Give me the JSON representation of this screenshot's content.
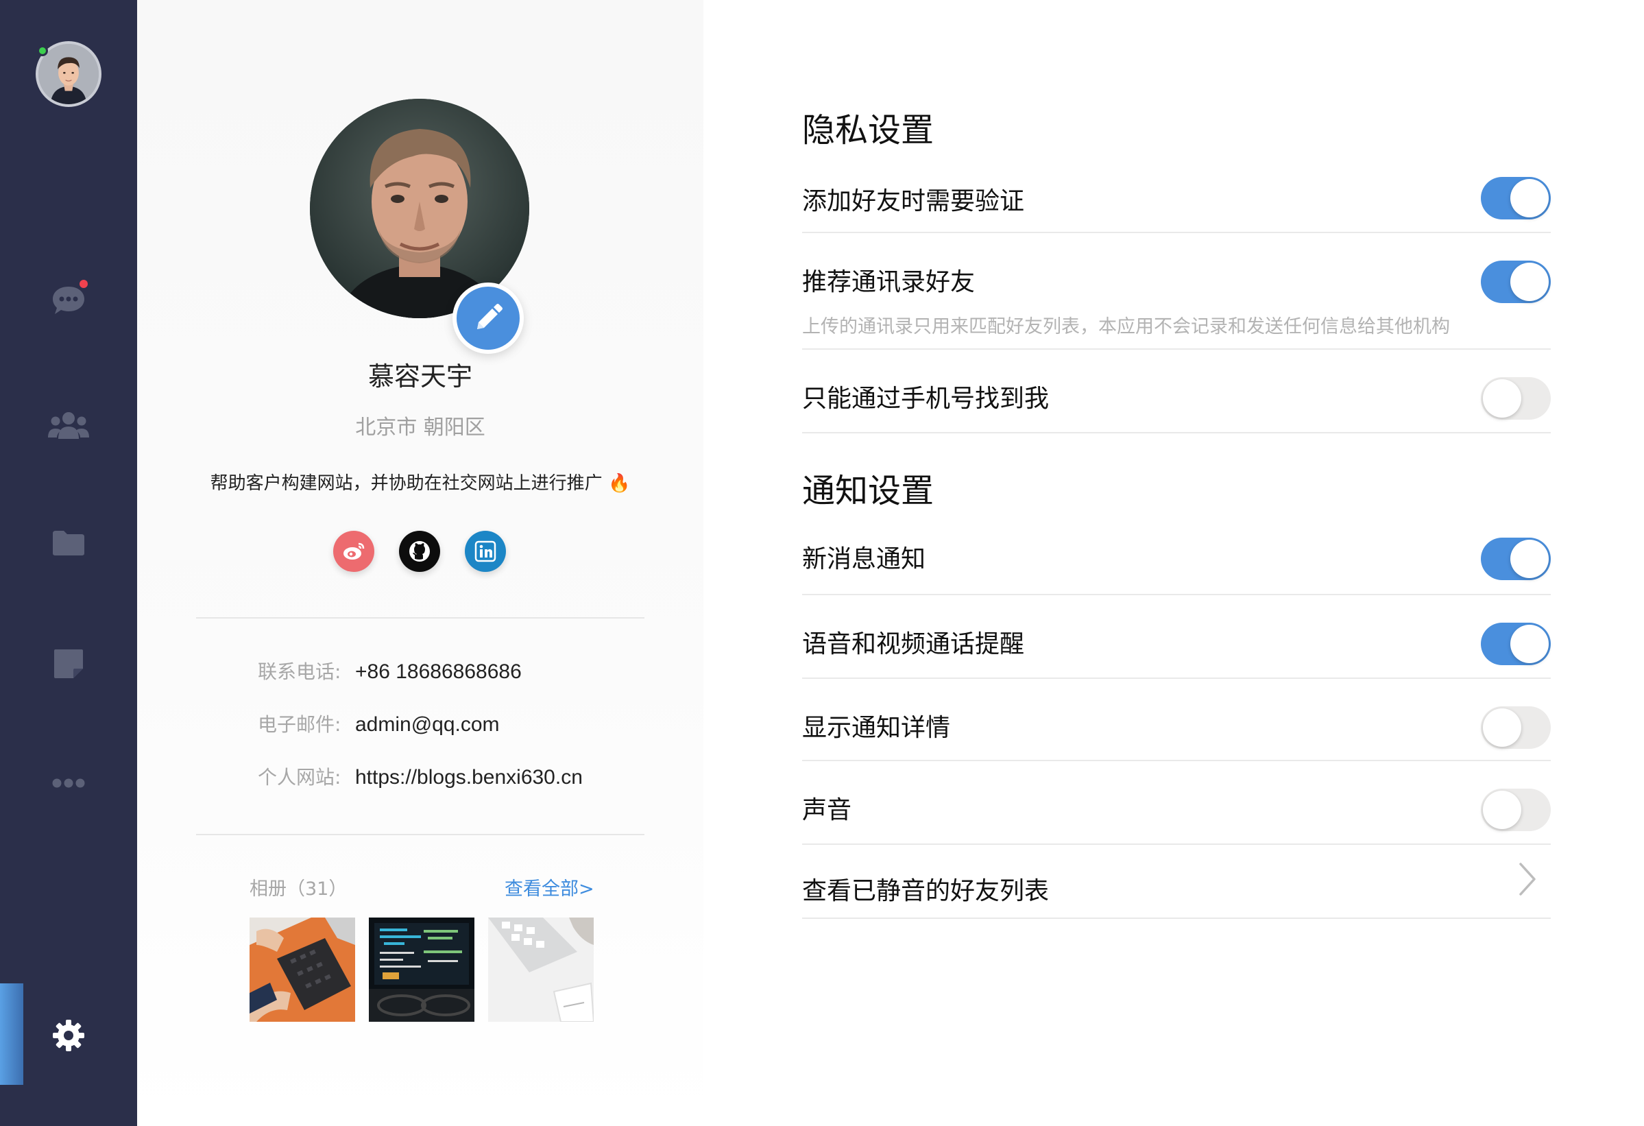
{
  "sidebar": {
    "user_online": true,
    "chat_unread": true,
    "icons": [
      "user-avatar",
      "chat-icon",
      "contacts-icon",
      "folder-icon",
      "note-icon",
      "more-icon",
      "settings-icon"
    ],
    "active_item": "settings-icon"
  },
  "profile": {
    "name": "慕容天宇",
    "location": "北京市 朝阳区",
    "bio": "帮助客户构建网站，并协助在社交网站上进行推广",
    "bio_emoji": "🔥",
    "socials": [
      "weibo",
      "github",
      "linkedin"
    ],
    "info": [
      {
        "label": "联系电话:",
        "value": "+86 18686868686"
      },
      {
        "label": "电子邮件:",
        "value": "admin@qq.com"
      },
      {
        "label": "个人网站:",
        "value": "https://blogs.benxi630.cn"
      }
    ],
    "album": {
      "title": "相册（31）",
      "link": "查看全部>"
    }
  },
  "settings": {
    "privacy_title": "隐私设置",
    "privacy": [
      {
        "label": "添加好友时需要验证",
        "on": true
      },
      {
        "label": "推荐通讯录好友",
        "desc": "上传的通讯录只用来匹配好友列表，本应用不会记录和发送任何信息给其他机构",
        "on": true
      },
      {
        "label": "只能通过手机号找到我",
        "on": false
      }
    ],
    "notify_title": "通知设置",
    "notify": [
      {
        "label": "新消息通知",
        "on": true
      },
      {
        "label": "语音和视频通话提醒",
        "on": true
      },
      {
        "label": "显示通知详情",
        "on": false
      },
      {
        "label": "声音",
        "on": false
      }
    ],
    "muted_link": "查看已静音的好友列表"
  },
  "colors": {
    "sidebar_bg": "#2b2f4a",
    "accent": "#4a8fdd",
    "online": "#3ccf4e",
    "badge": "#f0424f"
  }
}
